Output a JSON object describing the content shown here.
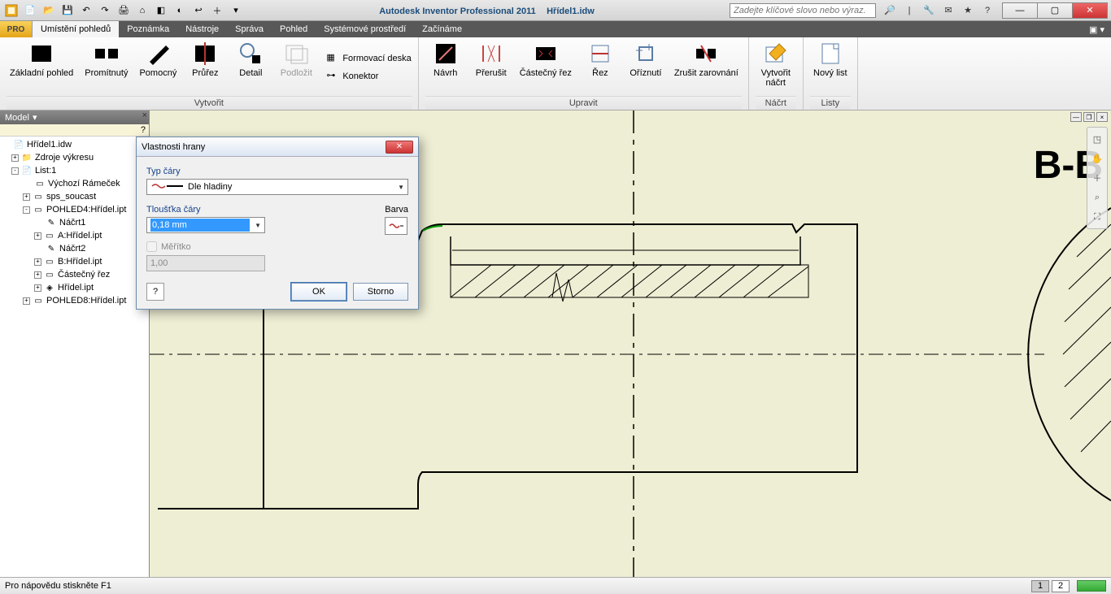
{
  "app": {
    "title": "Autodesk Inventor Professional 2011",
    "doc": "Hřídel1.idw",
    "search_placeholder": "Zadejte klíčové slovo nebo výraz."
  },
  "qat_icons": [
    "new-icon",
    "open-icon",
    "save-icon",
    "undo-icon",
    "redo-icon",
    "print-icon",
    "home-icon",
    "material-icon",
    "color-icon",
    "return-icon",
    "plus-icon",
    "dropdown-icon"
  ],
  "tabs": [
    "Umístění pohledů",
    "Poznámka",
    "Nástroje",
    "Správa",
    "Pohled",
    "Systémové prostředí",
    "Začínáme"
  ],
  "active_tab": 0,
  "ribbon": {
    "panel_create": {
      "label": "Vytvořit",
      "buttons": [
        "Základní pohled",
        "Promítnutý",
        "Pomocný",
        "Průřez",
        "Detail",
        "Podložit"
      ],
      "small": [
        {
          "icon": "mold-icon",
          "label": "Formovací deska"
        },
        {
          "icon": "connector-icon",
          "label": "Konektor"
        }
      ]
    },
    "panel_edit": {
      "label": "Upravit",
      "buttons": [
        "Návrh",
        "Přerušit",
        "Částečný řez",
        "Řez",
        "Oříznutí",
        "Zrušit zarovnání"
      ]
    },
    "panel_sketch": {
      "label": "Náčrt",
      "button": "Vytvořit\nnáčrt"
    },
    "panel_sheets": {
      "label": "Listy",
      "button": "Nový list"
    }
  },
  "browser": {
    "title": "Model",
    "nodes": [
      {
        "lvl": 0,
        "exp": "",
        "icon": "📄",
        "label": "Hřídel1.idw"
      },
      {
        "lvl": 1,
        "exp": "+",
        "icon": "📁",
        "label": "Zdroje výkresu"
      },
      {
        "lvl": 1,
        "exp": "-",
        "icon": "📄",
        "label": "List:1"
      },
      {
        "lvl": 2,
        "exp": "",
        "icon": "▭",
        "label": "Výchozí Rámeček"
      },
      {
        "lvl": 2,
        "exp": "+",
        "icon": "▭",
        "label": "sps_soucast"
      },
      {
        "lvl": 2,
        "exp": "-",
        "icon": "▭",
        "label": "POHLED4:Hřídel.ipt"
      },
      {
        "lvl": 3,
        "exp": "",
        "icon": "✎",
        "label": "Náčrt1"
      },
      {
        "lvl": 3,
        "exp": "+",
        "icon": "▭",
        "label": "A:Hřídel.ipt"
      },
      {
        "lvl": 3,
        "exp": "",
        "icon": "✎",
        "label": "Náčrt2"
      },
      {
        "lvl": 3,
        "exp": "+",
        "icon": "▭",
        "label": "B:Hřídel.ipt"
      },
      {
        "lvl": 3,
        "exp": "+",
        "icon": "▭",
        "label": "Částečný řez"
      },
      {
        "lvl": 3,
        "exp": "+",
        "icon": "◈",
        "label": "Hřídel.ipt"
      },
      {
        "lvl": 2,
        "exp": "+",
        "icon": "▭",
        "label": "POHLED8:Hřídel.ipt"
      }
    ]
  },
  "dialog": {
    "title": "Vlastnosti hrany",
    "line_type_label": "Typ čáry",
    "line_type_value": "Dle hladiny",
    "thickness_label": "Tloušťka čáry",
    "thickness_value": "0,18 mm",
    "color_label": "Barva",
    "scale_checkbox": "Měřítko",
    "scale_value": "1,00",
    "ok": "OK",
    "cancel": "Storno"
  },
  "canvas": {
    "section_label": "B-B"
  },
  "status": {
    "hint": "Pro nápovědu stiskněte F1",
    "pages": [
      "1",
      "2"
    ],
    "active_page": 0
  }
}
